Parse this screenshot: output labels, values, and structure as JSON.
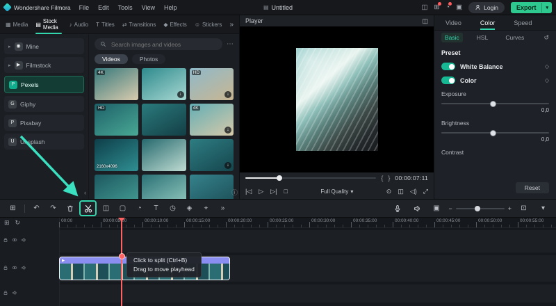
{
  "app": {
    "title": "Wondershare Filmora",
    "menus": [
      "File",
      "Edit",
      "Tools",
      "View",
      "Help"
    ],
    "project": "Untitled",
    "login": "Login",
    "export": "Export",
    "header_icons": [
      {
        "name": "layout-switch-icon",
        "glyph": "◫",
        "badge": false
      },
      {
        "name": "screen-share-icon",
        "glyph": "⊞",
        "badge": true
      },
      {
        "name": "notifications-icon",
        "glyph": "◔",
        "badge": true
      },
      {
        "name": "store-icon",
        "glyph": "▣",
        "badge": false
      }
    ]
  },
  "colors": {
    "accent": "#32d7ae",
    "export_green": "#2ec98e",
    "playhead_red": "#ff6262",
    "clip_purple": "#8a8ef0"
  },
  "glyphs": {
    "more": "»",
    "collapse": "‹",
    "dots": "⋯",
    "info": "ⓘ",
    "caret": "▾",
    "minus": "−",
    "plus": "+",
    "history": "↺",
    "diamond": "◇",
    "detach": "◫",
    "brace_in": "{",
    "brace_out": "}",
    "track_add": "⊞",
    "track_nav": "↻",
    "clip_play": "▶",
    "chev": "▸",
    "fit": "⊡",
    "proj_icon": "▤"
  },
  "media_tabs": {
    "active_index": 1,
    "items": [
      {
        "label": "Media",
        "glyph": "▦"
      },
      {
        "label": "Stock Media",
        "glyph": "▤"
      },
      {
        "label": "Audio",
        "glyph": "♪"
      },
      {
        "label": "Titles",
        "glyph": "T"
      },
      {
        "label": "Transitions",
        "glyph": "⇄"
      },
      {
        "label": "Effects",
        "glyph": "◆"
      },
      {
        "label": "Stickers",
        "glyph": "☺"
      }
    ]
  },
  "sidebar": {
    "active_index": 2,
    "items": [
      {
        "label": "Mine",
        "chev": true,
        "icon_text": "◉",
        "icon_bg": "#3b4047"
      },
      {
        "label": "Filmstock",
        "chev": true,
        "icon_text": "▶",
        "icon_bg": "#3b4047"
      },
      {
        "label": "Pexels",
        "chev": false,
        "icon_text": "P",
        "icon_bg": "#0fae8c"
      },
      {
        "label": "Giphy",
        "chev": false,
        "icon_text": "G",
        "icon_bg": "#3b4047"
      },
      {
        "label": "Pixabay",
        "chev": false,
        "icon_text": "P",
        "icon_bg": "#3b4047"
      },
      {
        "label": "Unsplash",
        "chev": false,
        "icon_text": "U",
        "icon_bg": "#3b4047"
      }
    ]
  },
  "stock": {
    "search_placeholder": "Search images and videos",
    "tabs": [
      "Videos",
      "Photos"
    ],
    "active_tab_index": 0,
    "thumbs": [
      {
        "badge": "4K",
        "label": "",
        "dl": false,
        "c1": "#37797c",
        "c2": "#d9cbae"
      },
      {
        "badge": "",
        "label": "",
        "dl": true,
        "c1": "#2e8a8d",
        "c2": "#a8d8d2"
      },
      {
        "badge": "HD",
        "label": "",
        "dl": true,
        "c1": "#8fb9c9",
        "c2": "#c9b692"
      },
      {
        "badge": "HD",
        "label": "",
        "dl": false,
        "c1": "#1e6069",
        "c2": "#49a894"
      },
      {
        "badge": "",
        "label": "",
        "dl": false,
        "c1": "#2a7a7c",
        "c2": "#133f46"
      },
      {
        "badge": "4K",
        "label": "",
        "dl": true,
        "c1": "#63aeb5",
        "c2": "#d6c9a9"
      },
      {
        "badge": "",
        "label": "2160x4096",
        "dl": false,
        "c1": "#0e3e49",
        "c2": "#2f8f92"
      },
      {
        "badge": "",
        "label": "",
        "dl": false,
        "c1": "#26696e",
        "c2": "#bfdcd2"
      },
      {
        "badge": "",
        "label": "",
        "dl": true,
        "c1": "#2d7d82",
        "c2": "#16464e"
      },
      {
        "badge": "",
        "label": "",
        "dl": false,
        "c1": "#1d5860",
        "c2": "#459e95"
      },
      {
        "badge": "",
        "label": "",
        "dl": false,
        "c1": "#2b7176",
        "c2": "#94cabf"
      },
      {
        "badge": "",
        "label": "",
        "dl": false,
        "c1": "#35828c",
        "c2": "#1c4d55"
      }
    ]
  },
  "player": {
    "title": "Player",
    "time": "00:00:07:11",
    "quality": "Full Quality",
    "progress": 26,
    "transport": [
      {
        "name": "previous-frame-button",
        "glyph": "|◁"
      },
      {
        "name": "play-button",
        "glyph": "▷"
      },
      {
        "name": "next-frame-button",
        "glyph": "▷|"
      },
      {
        "name": "stop-button",
        "glyph": "□"
      }
    ],
    "extra": [
      {
        "name": "snapshot-button",
        "glyph": "⊙"
      },
      {
        "name": "mini-player-button",
        "glyph": "◫"
      },
      {
        "name": "volume-button",
        "glyph": "◁)"
      },
      {
        "name": "fullscreen-button",
        "glyph": "⤢"
      }
    ]
  },
  "color_panel": {
    "tabs": [
      "Video",
      "Color",
      "Speed"
    ],
    "active_tab_index": 1,
    "sub_tabs": [
      "Basic",
      "HSL",
      "Curves"
    ],
    "active_sub_index": 0,
    "preset_label": "Preset",
    "keyframe_glyph": "◇",
    "toggles": [
      {
        "label": "White Balance",
        "on": true
      },
      {
        "label": "Color",
        "on": true
      }
    ],
    "sliders": [
      {
        "label": "Exposure",
        "value": "0,0",
        "pos": 48
      },
      {
        "label": "Brightness",
        "value": "0,0",
        "pos": 48
      },
      {
        "label": "Contrast",
        "value": null,
        "pos": 48
      }
    ],
    "reset_label": "Reset"
  },
  "toolbar": {
    "left": [
      {
        "name": "workspace-layout-button",
        "glyph": "⊞"
      },
      {
        "name": "divider",
        "divider": true
      },
      {
        "name": "undo-button",
        "glyph": "↶"
      },
      {
        "name": "redo-button",
        "glyph": "↷"
      },
      {
        "name": "delete-button",
        "sym": "trash"
      },
      {
        "name": "split-button",
        "sym": "scissors",
        "hl": true
      },
      {
        "name": "advanced-split-button",
        "glyph": "◫"
      },
      {
        "name": "crop-button",
        "glyph": "▢"
      },
      {
        "name": "speed-button",
        "glyph": "◔"
      },
      {
        "name": "text-button",
        "glyph": "T"
      },
      {
        "name": "duration-button",
        "glyph": "◷"
      },
      {
        "name": "keyframe-button",
        "glyph": "◈"
      },
      {
        "name": "marker-button",
        "glyph": "⌖"
      },
      {
        "name": "more-tools-button",
        "glyph": "»"
      }
    ],
    "right": [
      {
        "name": "voiceover-button",
        "sym": "mic"
      },
      {
        "name": "audio-mute-button",
        "sym": "speaker"
      },
      {
        "name": "render-preview-button",
        "glyph": "▣"
      }
    ],
    "zoom": {
      "pos": 45
    }
  },
  "timeline": {
    "ruler": [
      "00:00",
      "00:00:05:00",
      "00:00:10:00",
      "00:00:15:00",
      "00:00:20:00",
      "00:00:25:00",
      "00:00:30:00",
      "00:00:35:00",
      "00:00:40:00",
      "00:00:45:00",
      "00:00:50:00",
      "00:00:55:00"
    ],
    "tooltip_line1": "Click to split (Ctrl+B)",
    "tooltip_line2": "Drag to move playhead"
  }
}
